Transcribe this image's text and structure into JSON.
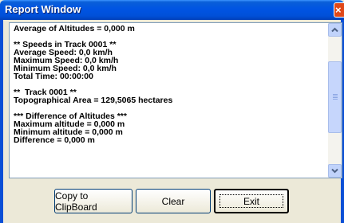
{
  "window": {
    "title": "Report Window",
    "close_glyph": "×"
  },
  "report": {
    "lines": [
      "Average of Altitudes = 0,000 m",
      "",
      "** Speeds in Track 0001 **",
      "Average Speed: 0,0 km/h",
      "Maximum Speed: 0,0 km/h",
      "Minimum Speed: 0,0 km/h",
      "Total Time: 00:00:00",
      "",
      "**  Track 0001 **",
      "Topographical Area = 129,5065 hectares",
      "",
      "*** Difference of Altitudes ***",
      "Maximum altitude = 0,000 m",
      "Minimum altitude = 0,000 m",
      "Difference = 0,000 m"
    ]
  },
  "buttons": {
    "copy": "Copy to ClipBoard",
    "clear": "Clear",
    "exit": "Exit"
  },
  "colors": {
    "titlebar": "#0054e3",
    "close": "#e04818",
    "face": "#ece9d8"
  }
}
